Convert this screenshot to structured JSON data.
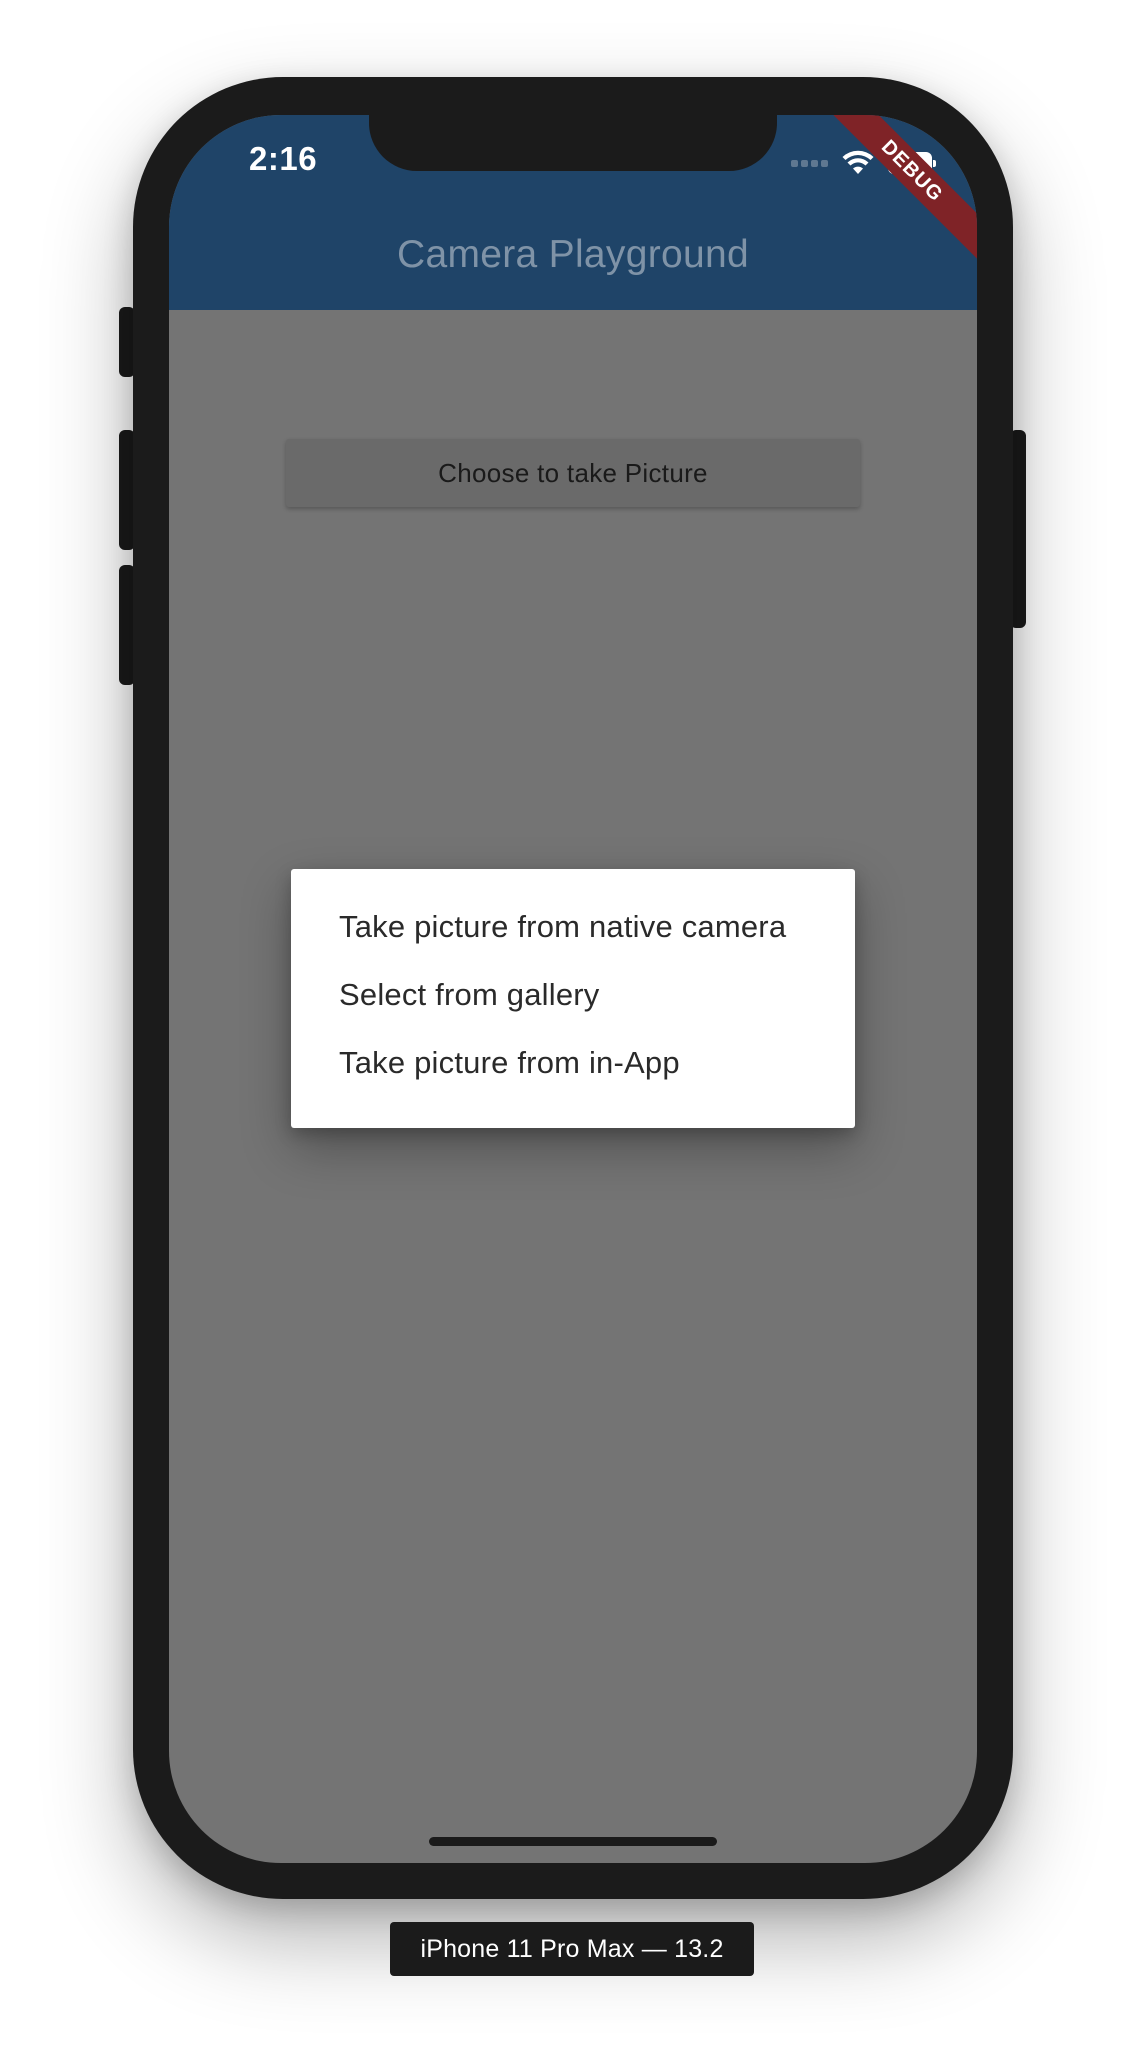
{
  "status_bar": {
    "time": "2:16",
    "icons": [
      "signal-dots-icon",
      "wifi-icon",
      "battery-icon"
    ]
  },
  "debug_banner": "DEBUG",
  "app_bar": {
    "title": "Camera Playground"
  },
  "main": {
    "take_picture_label": "Choose to take Picture"
  },
  "dialog": {
    "options": [
      "Take picture from native camera",
      "Select from gallery",
      "Take picture from in-App"
    ]
  },
  "device_label": "iPhone 11 Pro Max — 13.2",
  "colors": {
    "app_bar": "#1f4468",
    "scrim": "#747474",
    "debug_banner": "#7f2327",
    "dialog_bg": "#ffffff"
  }
}
